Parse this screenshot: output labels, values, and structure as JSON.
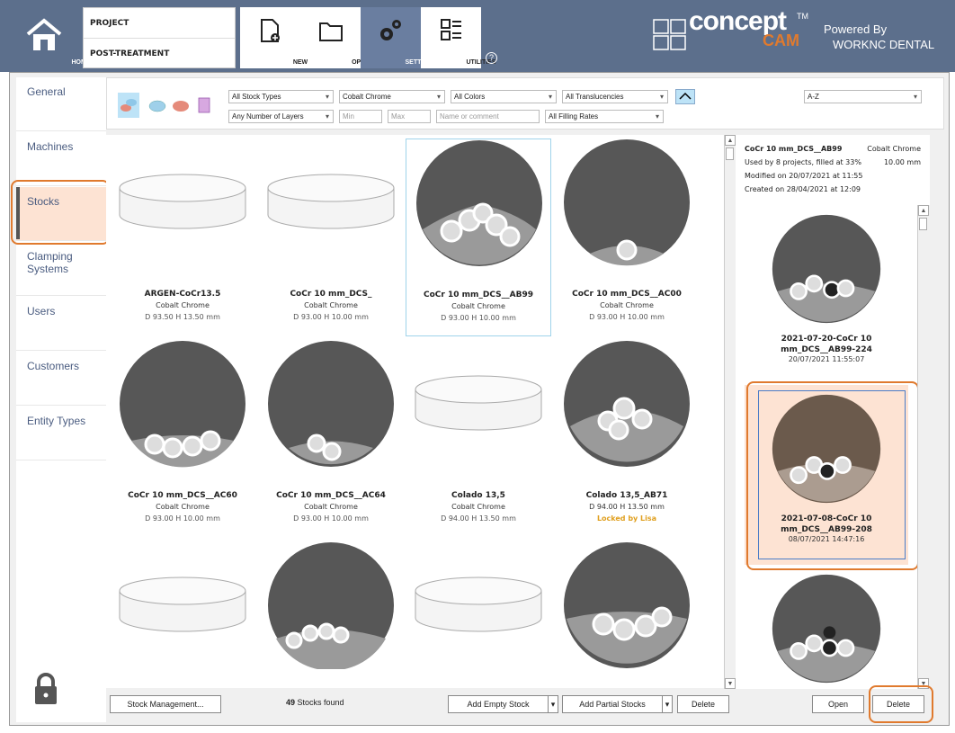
{
  "home": {
    "label": "HOME"
  },
  "project": {
    "row1": "PROJECT",
    "row2": "POST-TREATMENT"
  },
  "toolbar": {
    "new": "NEW",
    "open": "OPEN",
    "settings": "SETTINGS",
    "utilities": "UTILITIES",
    "help": "?"
  },
  "brand": {
    "concept": "concept",
    "cam": "CAM",
    "tm": "TM",
    "powered": "Powered By",
    "worknc": "WORKNC DENTAL"
  },
  "sidebar": {
    "items": [
      {
        "label": "General"
      },
      {
        "label": "Machines"
      },
      {
        "label": "Stocks"
      },
      {
        "label": "Clamping Systems"
      },
      {
        "label": "Users"
      },
      {
        "label": "Customers"
      },
      {
        "label": "Entity Types"
      }
    ]
  },
  "filters": {
    "stock_types": "All Stock Types",
    "material": "Cobalt Chrome",
    "colors": "All Colors",
    "translucencies": "All Translucencies",
    "sort": "A-Z",
    "layers": "Any Number of Layers",
    "min_placeholder": "Min",
    "max_placeholder": "Max",
    "name_placeholder": "Name or comment",
    "filling": "All Filling Rates"
  },
  "stocks": [
    {
      "name": "ARGEN-CoCr13.5",
      "material": "Cobalt Chrome",
      "dim": "D 93.50  H 13.50  mm",
      "kind": "empty"
    },
    {
      "name": "CoCr 10 mm_DCS_",
      "material": "Cobalt Chrome",
      "dim": "D 93.00  H 10.00  mm",
      "kind": "empty"
    },
    {
      "name": "CoCr 10 mm_DCS__AB99",
      "material": "Cobalt Chrome",
      "dim": "D 93.00  H 10.00  mm",
      "kind": "partial"
    },
    {
      "name": "CoCr 10 mm_DCS__AC00",
      "material": "Cobalt Chrome",
      "dim": "D 93.00  H 10.00  mm",
      "kind": "partial"
    },
    {
      "name": "CoCr 10 mm_DCS__AC60",
      "material": "Cobalt Chrome",
      "dim": "D 93.00  H 10.00  mm",
      "kind": "partial"
    },
    {
      "name": "CoCr 10 mm_DCS__AC64",
      "material": "Cobalt Chrome",
      "dim": "D 93.00  H 10.00  mm",
      "kind": "partial"
    },
    {
      "name": "Colado 13,5",
      "material": "Cobalt Chrome",
      "dim": "D 94.00  H 13.50  mm",
      "kind": "empty"
    },
    {
      "name": "Colado 13,5_AB71",
      "material": "D 94.00  H 13.50  mm",
      "dim": "Locked by Lisa",
      "kind": "partial"
    }
  ],
  "bottom": {
    "stock_mgmt": "Stock Management...",
    "count_num": "49",
    "count_text": " Stocks found",
    "add_empty": "Add Empty Stock",
    "add_partial": "Add Partial Stocks",
    "delete": "Delete",
    "open": "Open",
    "delete2": "Delete"
  },
  "info": {
    "name": "CoCr 10 mm_DCS__AB99",
    "material": "Cobalt Chrome",
    "used": "Used by 8 projects, filled at 33%",
    "height": "10.00 mm",
    "modified": "Modified on 20/07/2021 at 11:55",
    "created": "Created on 28/04/2021 at 12:09"
  },
  "projects": [
    {
      "name": "2021-07-20-CoCr 10 mm_DCS__AB99-224",
      "date": "20/07/2021 11:55:07"
    },
    {
      "name": "2021-07-08-CoCr 10 mm_DCS__AB99-208",
      "date": "08/07/2021 14:47:16"
    }
  ],
  "colors": {
    "accent": "#e07a2e",
    "header": "#5c6f8c",
    "selected": "#fde3d3",
    "disk": "#575757"
  }
}
